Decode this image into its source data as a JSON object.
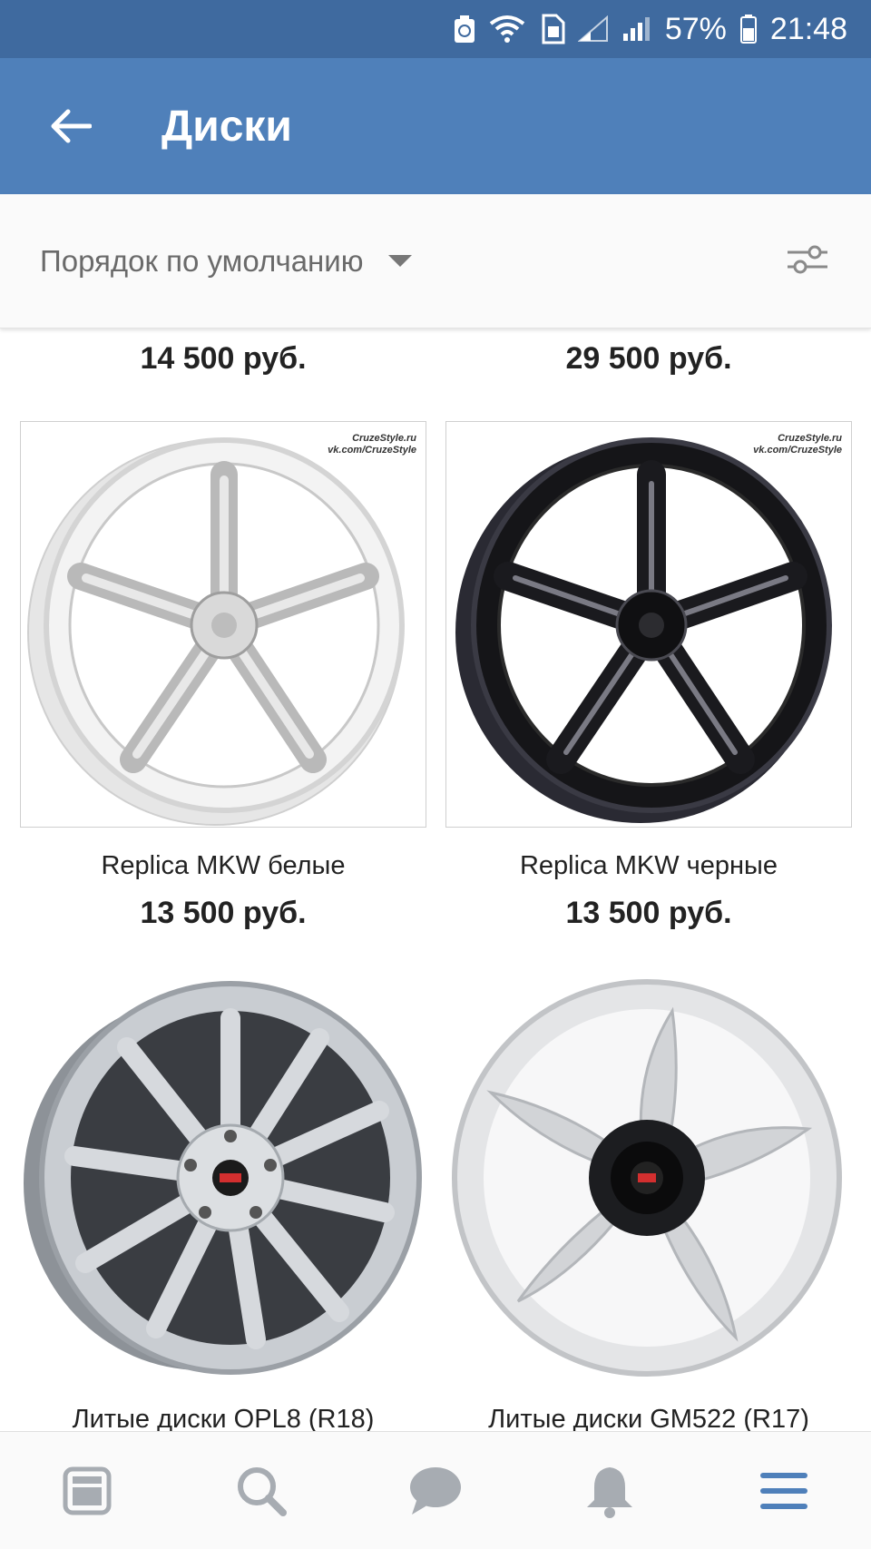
{
  "status_bar": {
    "battery": "57%",
    "time": "21:48"
  },
  "app_bar": {
    "title": "Диски"
  },
  "filter_bar": {
    "sort_label": "Порядок по умолчанию"
  },
  "top_row": {
    "left_price": "14 500 руб.",
    "right_price": "29 500 руб."
  },
  "products": [
    {
      "title": "Replica MKW белые",
      "price": "13 500 руб.",
      "watermark_1": "CruzeStyle.ru",
      "watermark_2": "vk.com/CruzeStyle"
    },
    {
      "title": "Replica MKW черные",
      "price": "13 500 руб.",
      "watermark_1": "CruzeStyle.ru",
      "watermark_2": "vk.com/CruzeStyle"
    },
    {
      "title": "Литые диски OPL8 (R18)",
      "price": ""
    },
    {
      "title": "Литые диски GM522 (R17)",
      "price": ""
    }
  ],
  "colors": {
    "status_bar": "#3f6a9f",
    "app_bar": "#4f80ba",
    "active_nav": "#4f80ba",
    "inactive_nav": "#a7acb2"
  },
  "bottom_nav": [
    "feed-icon",
    "search-icon",
    "messages-icon",
    "notifications-icon",
    "menu-icon"
  ]
}
